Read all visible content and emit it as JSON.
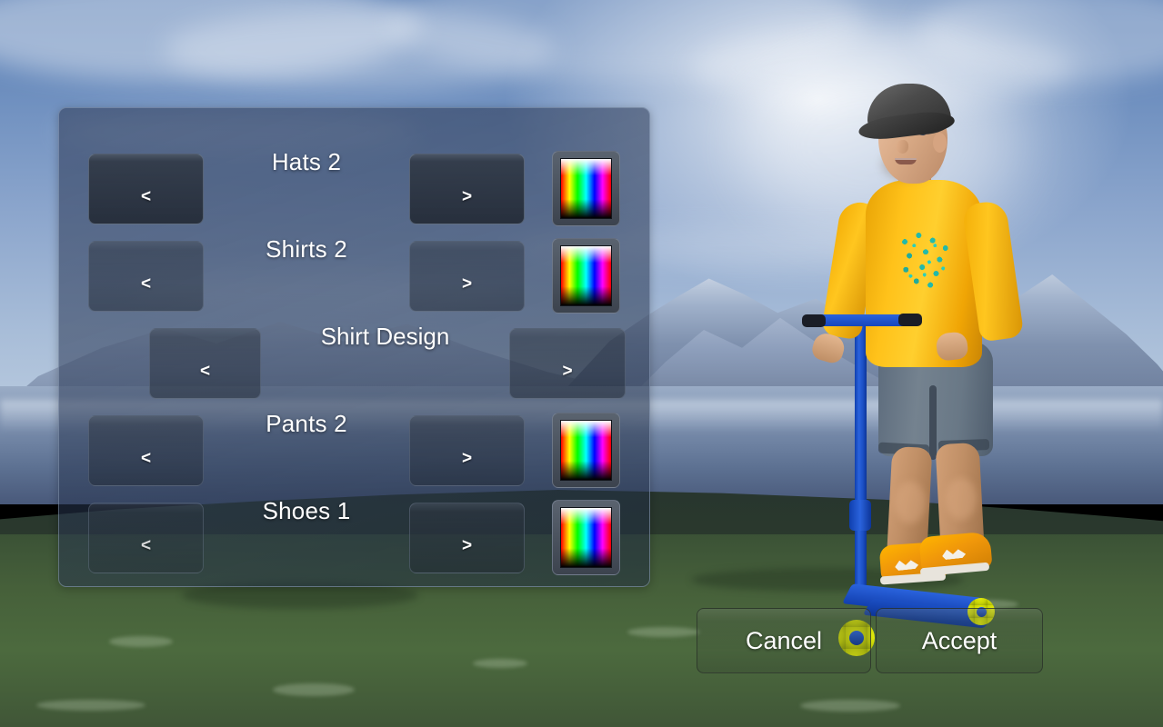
{
  "panel": {
    "rows": [
      {
        "id": "hats",
        "label": "Hats 2",
        "prev": "<",
        "next": ">",
        "has_color": true,
        "wide": false,
        "color_swatch_name": "hue-gradient"
      },
      {
        "id": "shirts",
        "label": "Shirts 2",
        "prev": "<",
        "next": ">",
        "has_color": true,
        "wide": false,
        "color_swatch_name": "hue-gradient"
      },
      {
        "id": "design",
        "label": "Shirt Design",
        "prev": "<",
        "next": ">",
        "has_color": false,
        "wide": true,
        "color_swatch_name": ""
      },
      {
        "id": "pants",
        "label": "Pants 2",
        "prev": "<",
        "next": ">",
        "has_color": true,
        "wide": false,
        "color_swatch_name": "hue-gradient"
      },
      {
        "id": "shoes",
        "label": "Shoes 1",
        "prev": "<",
        "next": ">",
        "has_color": true,
        "wide": false,
        "color_swatch_name": "hue-gradient"
      }
    ]
  },
  "actions": {
    "cancel_label": "Cancel",
    "accept_label": "Accept"
  },
  "character": {
    "hat_color": "#2e2e2e",
    "shirt_color": "#ffc21a",
    "shirt_design_color": "#19b9b0",
    "pants_color": "#697886",
    "shoes_color": "#f0970a",
    "skin_color": "#d8a985",
    "scooter_frame_color": "#1b4fc4",
    "scooter_wheel_color": "#c9d405"
  },
  "scene": {
    "sky_color": "#8ba5cc",
    "mountain_color": "#9fb0ca",
    "lake_color": "#7b8fae",
    "grass_color": "#4c6a3e"
  },
  "theme": {
    "panel_bg": "#344260",
    "panel_border": "#a0b2cd",
    "button_bg": "#303844",
    "text_color": "#ffffff"
  }
}
